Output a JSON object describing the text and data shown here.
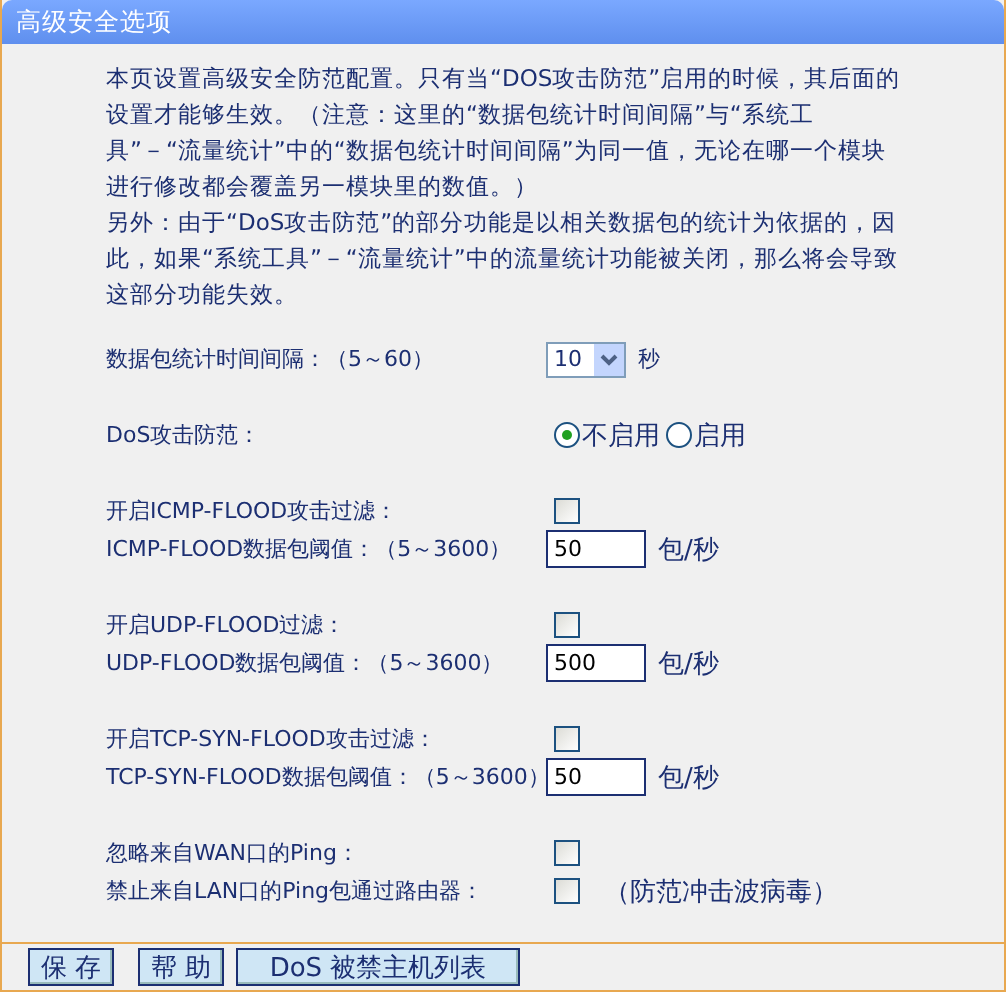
{
  "window": {
    "title": "高级安全选项"
  },
  "intro": [
    "本页设置高级安全防范配置。只有当“DOS攻击防范”启用的时候，其后面的设置才能够生效。（注意：这里的“数据包统计时间间隔”与“系统工具”－“流量统计”中的“数据包统计时间间隔”为同一值，无论在哪一个模块进行修改都会覆盖另一模块里的数值。）",
    "另外：由于“DoS攻击防范”的部分功能是以相关数据包的统计为依据的，因此，如果“系统工具”－“流量统计”中的流量统计功能被关闭，那么将会导致这部分功能失效。"
  ],
  "groups": [
    {
      "rows": [
        {
          "kind": "select",
          "label": "数据包统计时间间隔：（5～60）",
          "value": "10",
          "unit": "秒"
        }
      ]
    },
    {
      "rows": [
        {
          "kind": "radio",
          "label": "DoS攻击防范：",
          "options": [
            {
              "label": "不启用",
              "selected": true
            },
            {
              "label": "启用",
              "selected": false
            }
          ]
        }
      ]
    },
    {
      "rows": [
        {
          "kind": "checkbox",
          "label": "开启ICMP-FLOOD攻击过滤：",
          "checked": false
        },
        {
          "kind": "number",
          "label": "ICMP-FLOOD数据包阈值：（5～3600）",
          "value": "50",
          "unit": "包/秒"
        }
      ]
    },
    {
      "rows": [
        {
          "kind": "checkbox",
          "label": "开启UDP-FLOOD过滤：",
          "checked": false
        },
        {
          "kind": "number",
          "label": "UDP-FLOOD数据包阈值：（5～3600）",
          "value": "500",
          "unit": "包/秒"
        }
      ]
    },
    {
      "rows": [
        {
          "kind": "checkbox",
          "label": "开启TCP-SYN-FLOOD攻击过滤：",
          "checked": false
        },
        {
          "kind": "number",
          "label": "TCP-SYN-FLOOD数据包阈值：（5～3600）",
          "value": "50",
          "unit": "包/秒"
        }
      ]
    },
    {
      "rows": [
        {
          "kind": "checkbox",
          "label": "忽略来自WAN口的Ping：",
          "checked": false
        },
        {
          "kind": "checkbox",
          "label": "禁止来自LAN口的Ping包通过路由器：",
          "checked": false,
          "note": "（防范冲击波病毒）"
        }
      ]
    }
  ],
  "buttons": [
    {
      "label": "保 存",
      "kind": "small"
    },
    {
      "label": "帮 助",
      "kind": "small"
    },
    {
      "label": "DoS 被禁主机列表",
      "kind": "wide"
    }
  ]
}
